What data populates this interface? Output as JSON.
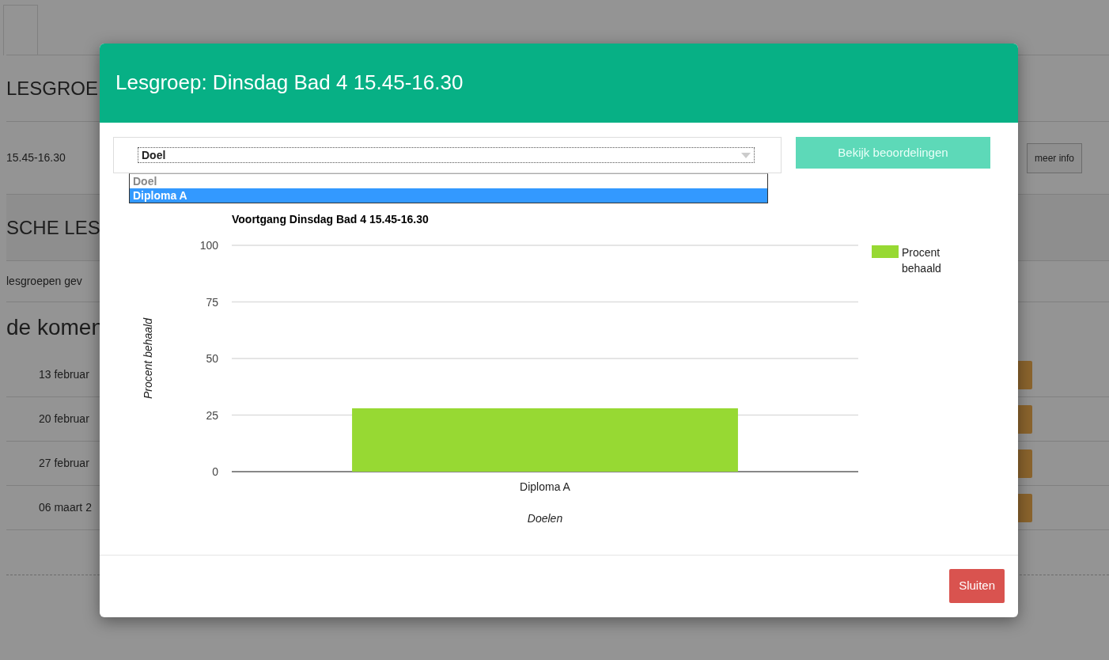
{
  "background_page": {
    "heading_1": "LESGROE",
    "row_time": "15.45-16.30",
    "more_info_button": "meer info",
    "heading_2": "SCHE LES",
    "notice": "lesgroepen gev",
    "heading_3": "de komen",
    "dates": [
      "13 februar",
      "20 februar",
      "27 februar",
      "06 maart 2"
    ]
  },
  "modal": {
    "title": "Lesgroep: Dinsdag Bad 4 15.45-16.30",
    "select": {
      "value": "Doel",
      "expanded": true,
      "options": [
        {
          "label": "Doel",
          "disabled": true,
          "highlighted": false
        },
        {
          "label": "Diploma A",
          "disabled": false,
          "highlighted": true
        }
      ]
    },
    "view_button": "Bekijk beoordelingen",
    "chart": {
      "chart_data": {
        "type": "bar",
        "title": "Voortgang Dinsdag Bad 4 15.45-16.30",
        "xlabel": "Doelen",
        "ylabel": "Procent behaald",
        "categories": [
          "Diploma A"
        ],
        "series": [
          {
            "name": "Procent behaald",
            "color": "#97d933",
            "values": [
              28
            ]
          }
        ],
        "ylim": [
          0,
          100
        ],
        "grid": true,
        "yticks": [
          0,
          25,
          50,
          75,
          100
        ]
      }
    },
    "close_button": "Sluiten"
  }
}
